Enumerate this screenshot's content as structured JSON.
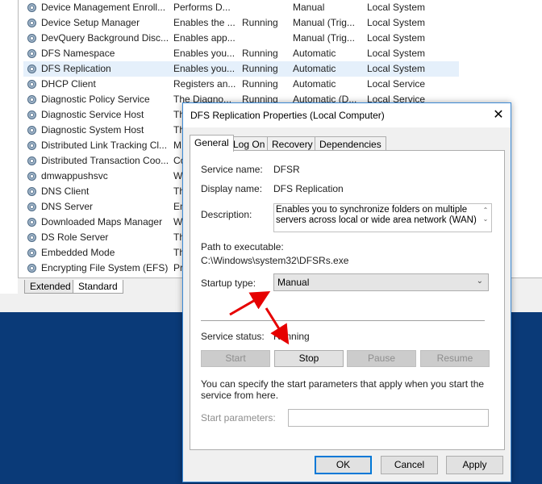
{
  "services": [
    {
      "name": "Device Management Enroll...",
      "description": "Performs D...",
      "status": "",
      "startup": "Manual",
      "logon": "Local System"
    },
    {
      "name": "Device Setup Manager",
      "description": "Enables the ...",
      "status": "Running",
      "startup": "Manual (Trig...",
      "logon": "Local System"
    },
    {
      "name": "DevQuery Background Disc...",
      "description": "Enables app...",
      "status": "",
      "startup": "Manual (Trig...",
      "logon": "Local System"
    },
    {
      "name": "DFS Namespace",
      "description": "Enables you...",
      "status": "Running",
      "startup": "Automatic",
      "logon": "Local System"
    },
    {
      "name": "DFS Replication",
      "description": "Enables you...",
      "status": "Running",
      "startup": "Automatic",
      "logon": "Local System",
      "selected": true
    },
    {
      "name": "DHCP Client",
      "description": "Registers an...",
      "status": "Running",
      "startup": "Automatic",
      "logon": "Local Service"
    },
    {
      "name": "Diagnostic Policy Service",
      "description": "The Diagno...",
      "status": "Running",
      "startup": "Automatic (D...",
      "logon": "Local Service"
    },
    {
      "name": "Diagnostic Service Host",
      "description": "Th",
      "status": "",
      "startup": "",
      "logon": ""
    },
    {
      "name": "Diagnostic System Host",
      "description": "Th",
      "status": "",
      "startup": "",
      "logon": ""
    },
    {
      "name": "Distributed Link Tracking Cl...",
      "description": "M",
      "status": "",
      "startup": "",
      "logon": ""
    },
    {
      "name": "Distributed Transaction Coo...",
      "description": "Co",
      "status": "",
      "startup": "",
      "logon": ""
    },
    {
      "name": "dmwappushsvc",
      "description": "W.",
      "status": "",
      "startup": "",
      "logon": ""
    },
    {
      "name": "DNS Client",
      "description": "Th",
      "status": "",
      "startup": "",
      "logon": ""
    },
    {
      "name": "DNS Server",
      "description": "En",
      "status": "",
      "startup": "",
      "logon": ""
    },
    {
      "name": "Downloaded Maps Manager",
      "description": "W",
      "status": "",
      "startup": "",
      "logon": ""
    },
    {
      "name": "DS Role Server",
      "description": "Th",
      "status": "",
      "startup": "",
      "logon": ""
    },
    {
      "name": "Embedded Mode",
      "description": "Th",
      "status": "",
      "startup": "",
      "logon": ""
    },
    {
      "name": "Encrypting File System (EFS)",
      "description": "Pr",
      "status": "",
      "startup": "",
      "logon": ""
    }
  ],
  "bottom_tabs": {
    "extended": "Extended",
    "standard": "Standard"
  },
  "dialog": {
    "title": "DFS Replication Properties (Local Computer)",
    "close_glyph": "✕",
    "tabs": {
      "general": "General",
      "logon": "Log On",
      "recovery": "Recovery",
      "dependencies": "Dependencies"
    },
    "service_name_label": "Service name:",
    "service_name": "DFSR",
    "display_name_label": "Display name:",
    "display_name": "DFS Replication",
    "description_label": "Description:",
    "description": "Enables you to synchronize folders on multiple servers across local or wide area network (WAN)",
    "path_label": "Path to executable:",
    "path": "C:\\Windows\\system32\\DFSRs.exe",
    "startup_type_label": "Startup type:",
    "startup_type": "Manual",
    "status_label": "Service status:",
    "status": "Running",
    "buttons": {
      "start": "Start",
      "stop": "Stop",
      "pause": "Pause",
      "resume": "Resume"
    },
    "hint": "You can specify the start parameters that apply when you start the service from here.",
    "params_label": "Start parameters:",
    "params_value": "",
    "footer": {
      "ok": "OK",
      "cancel": "Cancel",
      "apply": "Apply"
    }
  },
  "colors": {
    "annotation_arrow": "#e60000",
    "desktop": "#0a3a78",
    "selection": "#e5f0fb",
    "focus_border": "#0078d7"
  }
}
